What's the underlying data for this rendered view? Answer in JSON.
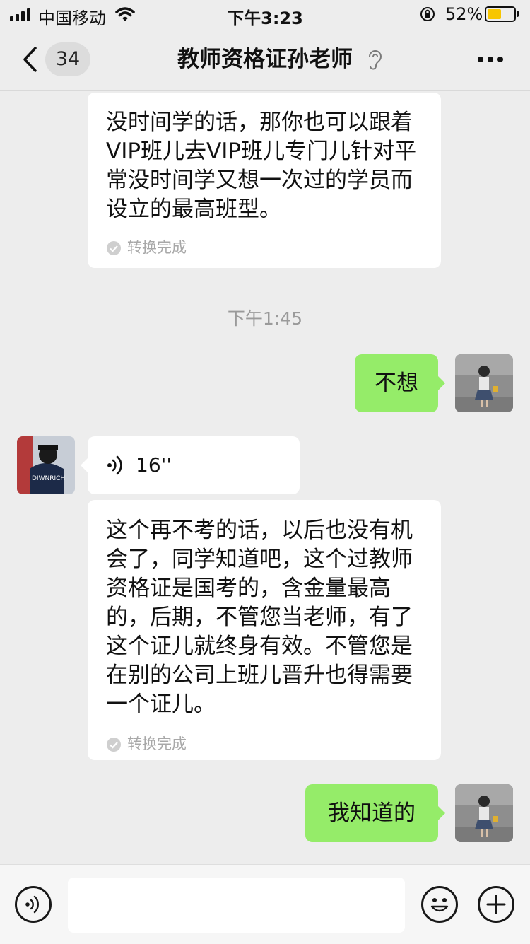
{
  "status_bar": {
    "carrier": "中国移动",
    "time": "下午3:23",
    "battery_percent": "52%",
    "battery_level": 0.52,
    "icons": [
      "signal-icon",
      "wifi-icon",
      "rotation-lock-icon",
      "battery-icon"
    ]
  },
  "nav": {
    "unread_count": "34",
    "title": "教师资格证孙老师",
    "icons": [
      "back-icon",
      "earpiece-mode-icon",
      "more-icon"
    ]
  },
  "messages": [
    {
      "side": "left",
      "type": "voice-text",
      "text": "没时间学的话，那你也可以跟着VIP班儿去VIP班儿专门儿针对平常没时间学又想一次过的学员而设立的最高班型。",
      "status": "转换完成"
    },
    {
      "type": "timestamp",
      "text": "下午1:45"
    },
    {
      "side": "right",
      "type": "text",
      "text": "不想"
    },
    {
      "side": "left",
      "type": "voice",
      "duration": "16''"
    },
    {
      "side": "left",
      "type": "voice-text",
      "text": "这个再不考的话，以后也没有机会了，同学知道吧，这个过教师资格证是国考的，含金量最高的，后期，不管您当老师，有了这个证儿就终身有效。不管您是在别的公司上班儿晋升也得需要一个证儿。",
      "status": "转换完成"
    },
    {
      "side": "right",
      "type": "text",
      "text": "我知道的"
    }
  ],
  "input_bar": {
    "value": "",
    "icons": [
      "voice-input-icon",
      "emoji-icon",
      "plus-icon"
    ]
  },
  "colors": {
    "background": "#ededed",
    "sent_bubble": "#95ec69",
    "received_bubble": "#ffffff",
    "battery": "#f7c600"
  }
}
